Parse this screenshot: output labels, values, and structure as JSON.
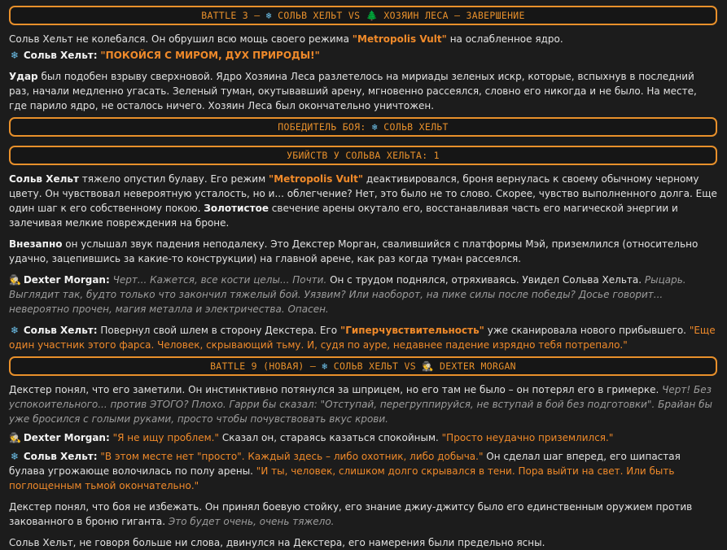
{
  "banners": {
    "b1": {
      "pre": "BATTLE 3 – ",
      "a": "СОЛЬВ ХЕЛЬТ VS ",
      "b": " ХОЗЯИН ЛЕСА – ЗАВЕРШЕНИЕ"
    },
    "winner": {
      "pre": "ПОБЕДИТЕЛЬ БОЯ: ",
      "a": " СОЛЬВ ХЕЛЬТ"
    },
    "kills": "УБИЙСТВ У СОЛЬВА ХЕЛЬТА: 1",
    "b9": {
      "pre": "BATTLE 9 (НОВАЯ) – ",
      "a": " СОЛЬВ ХЕЛЬТ VS ",
      "b": " DEXTER MORGAN"
    }
  },
  "icons": {
    "snowflake": "❄",
    "tree": "🌲",
    "detective": "🕵"
  },
  "names": {
    "solv": "Сольв Хельт:",
    "dexter": "Dexter Morgan:"
  },
  "p1": {
    "a": "Сольв Хельт не колебался. Он обрушил всю мощь своего режима ",
    "q": "\"Metropolis Vult\"",
    "b": " на ослабленное ядро."
  },
  "p2": {
    "q": "\"ПОКОЙСЯ С МИРОМ, ДУХ ПРИРОДЫ!\""
  },
  "p3": {
    "bold": "Удар",
    "a": " был подобен взрыву сверхновой. Ядро Хозяина Леса разлетелось на мириады зеленых искр, которые, вспыхнув в последний раз, начали медленно угасать. Зеленый туман, окутывавший арену, мгновенно рассеялся, словно его никогда и не было. На месте, где парило ядро, не осталось ничего. Хозяин Леса был окончательно уничтожен."
  },
  "p4": {
    "bold1": "Сольв Хельт",
    "a": " тяжело опустил булаву. Его режим ",
    "q": "\"Metropolis Vult\"",
    "b": " деактивировался, броня вернулась к своему обычному черному цвету. Он чувствовал невероятную усталость, но и... облегчение? Нет, это было не то слово. Скорее, чувство выполненного долга. Еще один шаг к его собственному покою. ",
    "bold2": "Золотистое",
    "c": " свечение арены окутало его, восстанавливая часть его магической энергии и залечивая мелкие повреждения на броне."
  },
  "p5": {
    "bold": "Внезапно",
    "a": " он услышал звук падения неподалеку. Это Декстер Морган, свалившийся с платформы Мэй, приземлился (относительно удачно, зацепившись за какие-то конструкции) на главной арене, как раз когда туман рассеялся."
  },
  "p6": {
    "i1": "Черт... Кажется, все кости целы... Почти.",
    "a": " Он с трудом поднялся, отряхиваясь. Увидел Сольва Хельта. ",
    "i2": "Рыцарь. Выглядит так, будто только что закончил тяжелый бой. Уязвим? Или наоборот, на пике силы после победы? Досье говорит... невероятно прочен, магия металла и электричества. Опасен."
  },
  "p7": {
    "a": " Повернул свой шлем в сторону Декстера. Его ",
    "q": "\"Гиперчувствительность\"",
    "b": " уже сканировала нового прибывшего. ",
    "q2": "\"Еще один участник этого фарса. Человек, скрывающий тьму. И, судя по ауре, недавнее падение изрядно тебя потрепало.\""
  },
  "p8": {
    "a": "Декстер понял, что его заметили. Он инстинктивно потянулся за шприцем, но его там не было – он потерял его в гримерке. ",
    "i1": "Черт! Без успокоительного... против ЭТОГО? Плохо. Гарри бы сказал: ",
    "q": "\"Отступай, перегруппируйся, не вступай в бой без подготовки\"",
    "i2": ". Брайан бы уже бросился с голыми руками, просто чтобы почувствовать вкус крови."
  },
  "p9": {
    "q": "\"Я не ищу проблем.\"",
    "a": " Сказал он, стараясь казаться спокойным. ",
    "q2": "\"Просто неудачно приземлился.\""
  },
  "p10": {
    "q": "\"В этом месте нет \"просто\". Каждый здесь – либо охотник, либо добыча.\"",
    "a": " Он сделал шаг вперед, его шипастая булава угрожающе волочилась по полу арены. ",
    "q2": "\"И ты, человек, слишком долго скрывался в тени. Пора выйти на свет. Или быть поглощенным тьмой окончательно.\""
  },
  "p11": {
    "a": "Декстер понял, что боя не избежать. Он принял боевую стойку, его знание джиу-джитсу было его единственным оружием против закованного в броню гиганта. ",
    "i": "Это будет очень, очень тяжело."
  },
  "p12": {
    "a": "Сольв Хельт, не говоря больше ни слова, двинулся на Декстера, его намерения были предельно ясны."
  }
}
